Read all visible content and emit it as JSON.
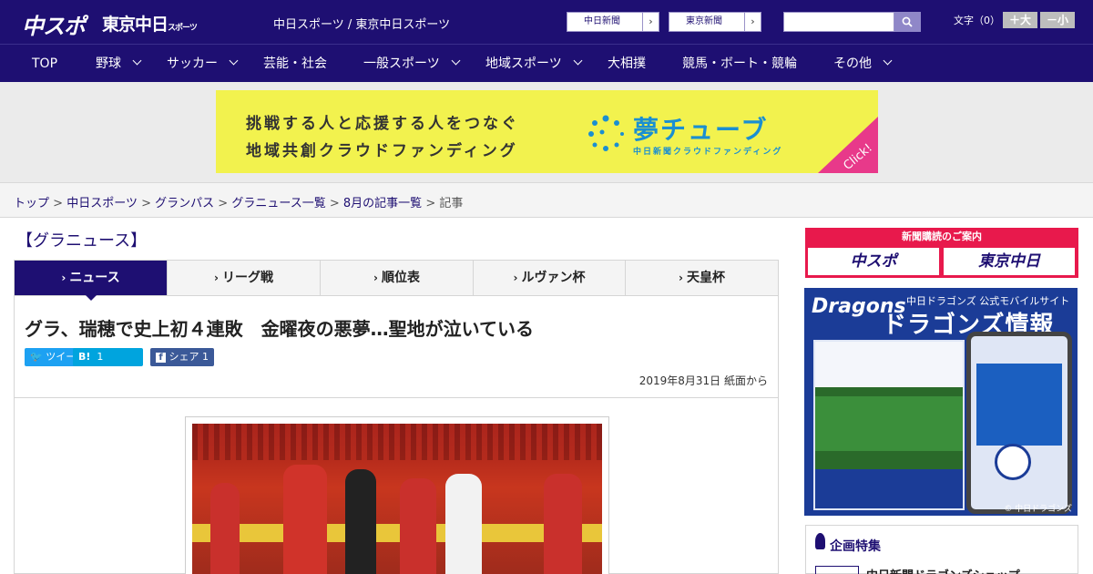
{
  "header": {
    "logo_chunichi": "中スポ",
    "logo_tokyo": "東京中日",
    "logo_tokyo_sub": "スポーツ",
    "site_names": "中日スポーツ / 東京中日スポーツ",
    "ext_links": [
      {
        "label": "中日新聞"
      },
      {
        "label": "東京新聞"
      }
    ],
    "search_placeholder": "",
    "font_size_label": "文字（0）",
    "font_bigger": "＋大",
    "font_smaller": "－小"
  },
  "nav": {
    "items": [
      {
        "label": "TOP"
      },
      {
        "label": "野球"
      },
      {
        "label": "サッカー"
      },
      {
        "label": "芸能・社会"
      },
      {
        "label": "一般スポーツ"
      },
      {
        "label": "地域スポーツ"
      },
      {
        "label": "大相撲"
      },
      {
        "label": "競馬・ボート・競輪"
      },
      {
        "label": "その他"
      }
    ]
  },
  "banner": {
    "line1": "挑戦する人と応援する人をつなぐ",
    "line2": "地域共創クラウドファンディング",
    "brand": "夢チューブ",
    "brand_sub": "中日新聞クラウドファンディング",
    "click": "Click!"
  },
  "breadcrumb": {
    "items": [
      "トップ",
      "中日スポーツ",
      "グランパス",
      "グラニュース一覧",
      "8月の記事一覧"
    ],
    "sep": ">",
    "current": "記事"
  },
  "section_title": "【グラニュース】",
  "tabs": [
    {
      "label": "ニュース"
    },
    {
      "label": "リーグ戦"
    },
    {
      "label": "順位表"
    },
    {
      "label": "ルヴァン杯"
    },
    {
      "label": "天皇杯"
    }
  ],
  "article": {
    "title": "グラ、瑞穂で史上初４連敗　金曜夜の悪夢…聖地が泣いている",
    "tweet_label": "ツイート",
    "hatena_label": "B!",
    "hatena_count": "1",
    "share_label": "シェア",
    "share_count": "1",
    "date": "2019年8月31日 紙面から"
  },
  "sidebar": {
    "subscribe_header": "新聞購読のご案内",
    "subscribe_chunichi": "中スポ",
    "subscribe_tokyo": "東京中日",
    "dragons_logo": "Dragons",
    "dragons_site": "中日ドラゴンズ 公式モバイルサイト",
    "dragons_title": "ドラゴンズ情報",
    "dragons_copy": "© 中日ドラゴンズ",
    "special_title": "企画特集",
    "special_item": "中日新聞ドラゴンズショップ"
  }
}
